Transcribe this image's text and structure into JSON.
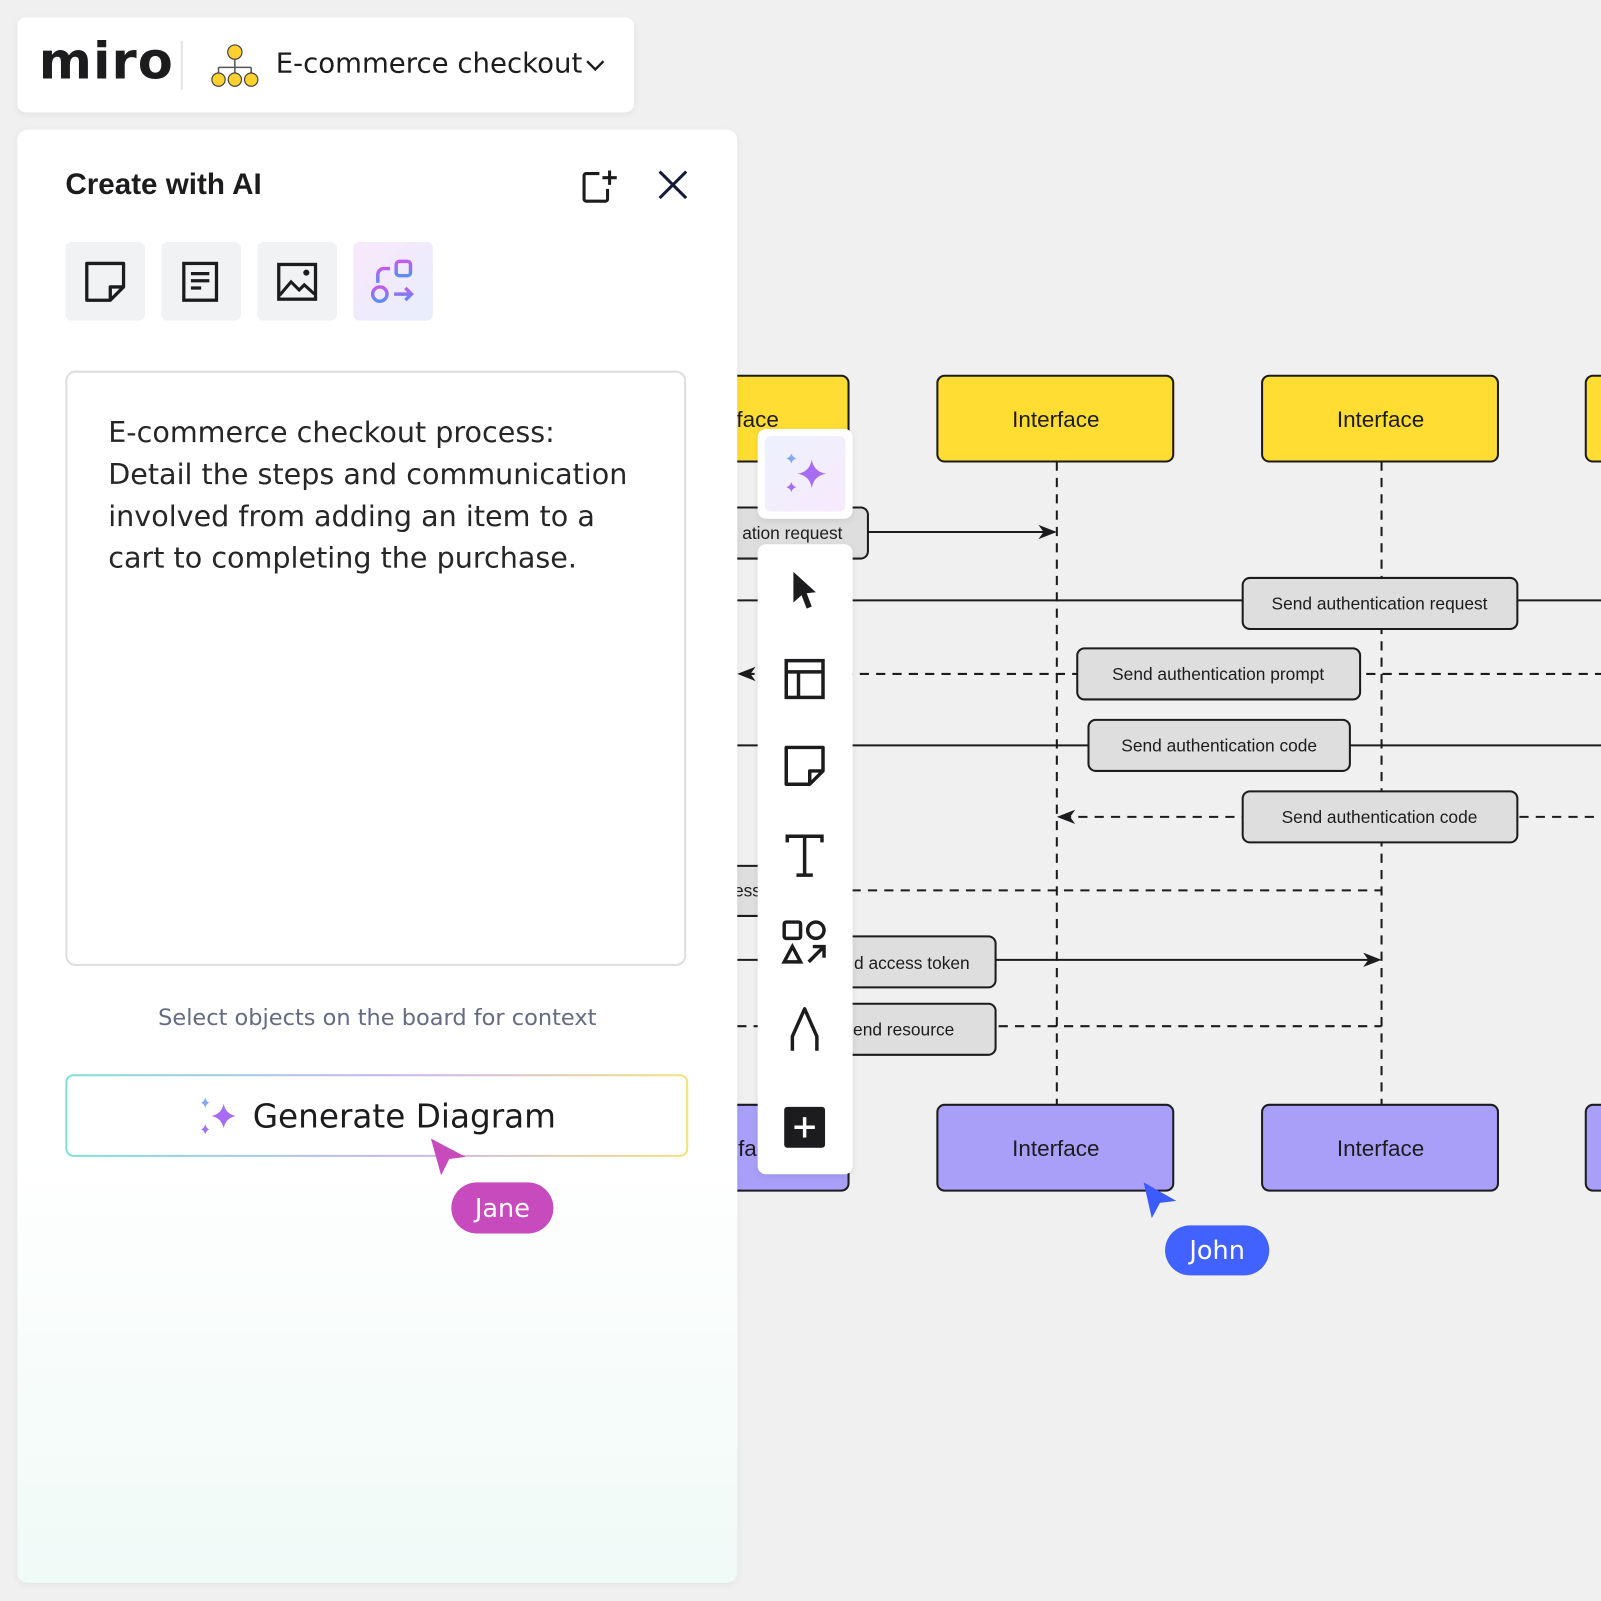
{
  "header": {
    "logo": "miro",
    "board_title": "E-commerce checkout",
    "board_icon": "org-chart-icon"
  },
  "panel": {
    "title": "Create with AI",
    "tabs": [
      {
        "name": "sticky-note",
        "icon": "sticky-note-icon"
      },
      {
        "name": "document",
        "icon": "document-icon"
      },
      {
        "name": "image",
        "icon": "image-icon"
      },
      {
        "name": "diagram",
        "icon": "diagram-icon",
        "active": true
      }
    ],
    "prompt_text": "E-commerce checkout process: Detail the steps and communication involved from adding an item to a cart to completing the purchase.",
    "hint": "Select objects on the board for context",
    "generate_label": "Generate Diagram"
  },
  "collaborators": [
    {
      "name": "Jane",
      "color": "#c84bbd"
    },
    {
      "name": "John",
      "color": "#4262ff"
    }
  ],
  "toolbar": {
    "tools": [
      "ai-assist",
      "select",
      "frames",
      "sticky-note",
      "text",
      "shapes",
      "pen",
      "add"
    ]
  },
  "diagram": {
    "colors": {
      "participant_top": "#ffdd33",
      "participant_bottom": "#a99ff9",
      "message_label": "#dedede",
      "canvas": "#f0f0f0"
    },
    "participants_top": [
      "face",
      "Interface",
      "Interface"
    ],
    "participants_bottom": [
      "fa",
      "Interface",
      "Interface"
    ],
    "messages": [
      {
        "label": "ation request",
        "style": "solid"
      },
      {
        "label": "Send authentication request",
        "style": "solid"
      },
      {
        "label": "Send authentication prompt",
        "style": "dashed"
      },
      {
        "label": "Send authentication code",
        "style": "solid"
      },
      {
        "label": "Send authentication code",
        "style": "dashed"
      },
      {
        "label": "ess",
        "style": "dashed"
      },
      {
        "label": "d access token",
        "style": "solid"
      },
      {
        "label": "end resource",
        "style": "dashed"
      }
    ]
  }
}
